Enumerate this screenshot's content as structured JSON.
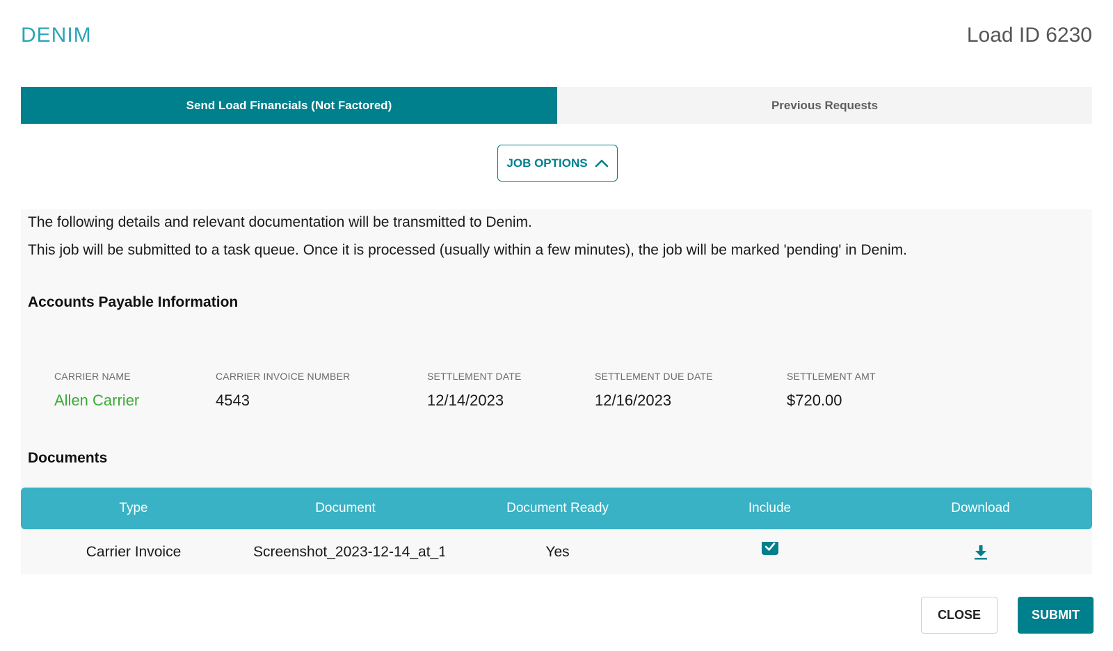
{
  "header": {
    "brand": "DENIM",
    "load_id": "Load ID 6230"
  },
  "tabs": [
    {
      "label": "Send Load Financials (Not Factored)",
      "active": true
    },
    {
      "label": "Previous Requests",
      "active": false
    }
  ],
  "job_options": {
    "label": "JOB OPTIONS",
    "icon": "chevron-up-icon"
  },
  "messages": {
    "line1": "The following details and relevant documentation will be transmitted to Denim.",
    "line2": "This job will be submitted to a task queue. Once it is processed (usually within a few minutes), the job will be marked 'pending' in Denim."
  },
  "accounts_payable": {
    "title": "Accounts Payable Information",
    "fields": [
      {
        "label": "CARRIER NAME",
        "value": "Allen Carrier"
      },
      {
        "label": "CARRIER INVOICE NUMBER",
        "value": "4543"
      },
      {
        "label": "SETTLEMENT DATE",
        "value": "12/14/2023"
      },
      {
        "label": "SETTLEMENT DUE DATE",
        "value": "12/16/2023"
      },
      {
        "label": "SETTLEMENT AMT",
        "value": "$720.00"
      }
    ]
  },
  "documents": {
    "title": "Documents",
    "columns": [
      "Type",
      "Document",
      "Document Ready",
      "Include",
      "Download"
    ],
    "rows": [
      {
        "type": "Carrier Invoice",
        "document": "Screenshot_2023-12-14_at_1",
        "ready": "Yes",
        "include": true,
        "download_icon": "download-icon"
      }
    ]
  },
  "footer": {
    "close_label": "CLOSE",
    "submit_label": "SUBMIT"
  },
  "colors": {
    "brand": "#2ba5b8",
    "primary": "#007f8c",
    "table_header": "#38b2c4",
    "link": "#3aaa35"
  }
}
